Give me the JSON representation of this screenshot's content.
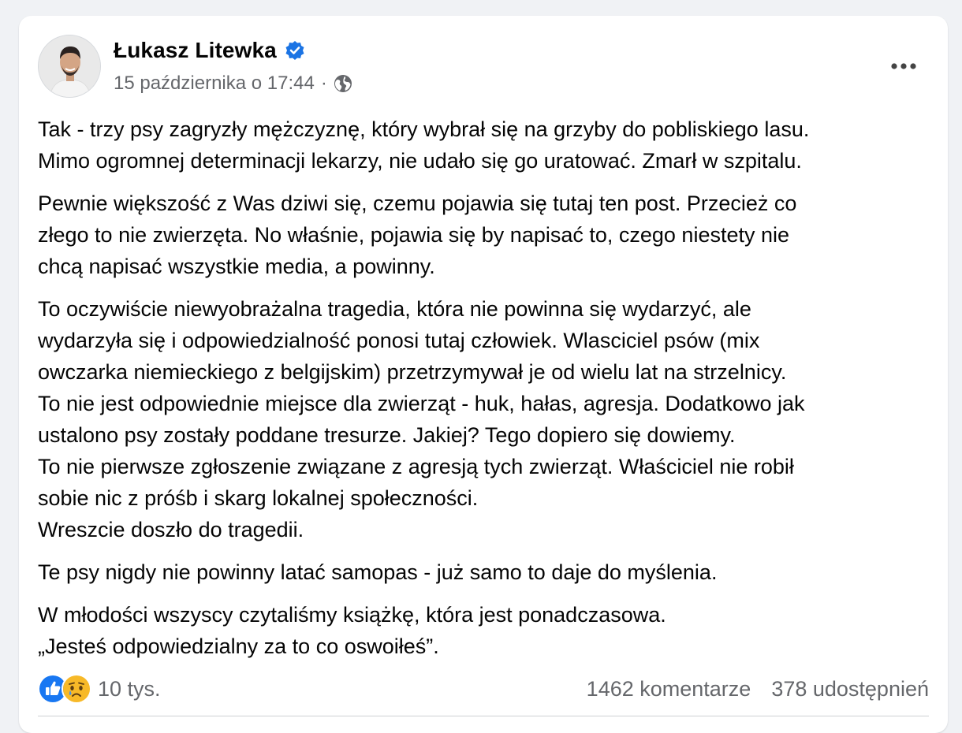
{
  "post": {
    "author": "Łukasz Litewka",
    "verified_icon": "verified-badge-icon",
    "date": "15 października o 17:44",
    "separator": "·",
    "audience_icon": "globe-icon",
    "more_icon": "more-options-icon",
    "paragraphs": [
      "Tak - trzy psy zagryzły mężczyznę, który wybrał się na grzyby do pobliskiego lasu.\nMimo ogromnej determinacji lekarzy, nie udało się go uratować. Zmarł w szpitalu.",
      "Pewnie większość z Was dziwi się, czemu pojawia się tutaj ten post. Przecież co\nzłego to nie zwierzęta. No właśnie, pojawia się by napisać to, czego niestety nie\nchcą napisać wszystkie media, a powinny.",
      "To oczywiście niewyobrażalna tragedia, która nie powinna się wydarzyć, ale\nwydarzyła się i odpowiedzialność ponosi tutaj człowiek. Wlasciciel psów (mix\nowczarka niemieckiego z belgijskim) przetrzymywał je od wielu lat na strzelnicy.\nTo nie jest odpowiednie miejsce dla zwierząt - huk, hałas, agresja. Dodatkowo jak\nustalono psy zostały poddane tresurze. Jakiej? Tego dopiero się dowiemy.\nTo nie pierwsze zgłoszenie związane z agresją tych zwierząt. Właściciel nie robił\nsobie nic z próśb i skarg lokalnej społeczności.\nWreszcie doszło do tragedii.",
      "Te psy nigdy nie powinny latać samopas - już samo to daje do myślenia.",
      "W młodości wszyscy czytaliśmy książkę, która jest ponadczasowa.\n„Jesteś odpowiedzialny za to co oswoiłeś”."
    ]
  },
  "footer": {
    "reaction_icons": [
      "like-icon",
      "sad-icon"
    ],
    "reaction_count": "10 tys.",
    "comments": "1462 komentarze",
    "shares": "378 udostępnień"
  },
  "colors": {
    "like_blue": "#1877f2",
    "sad_yellow": "#f7b928",
    "verified_blue": "#1b74e4",
    "meta_gray": "#65676b"
  }
}
